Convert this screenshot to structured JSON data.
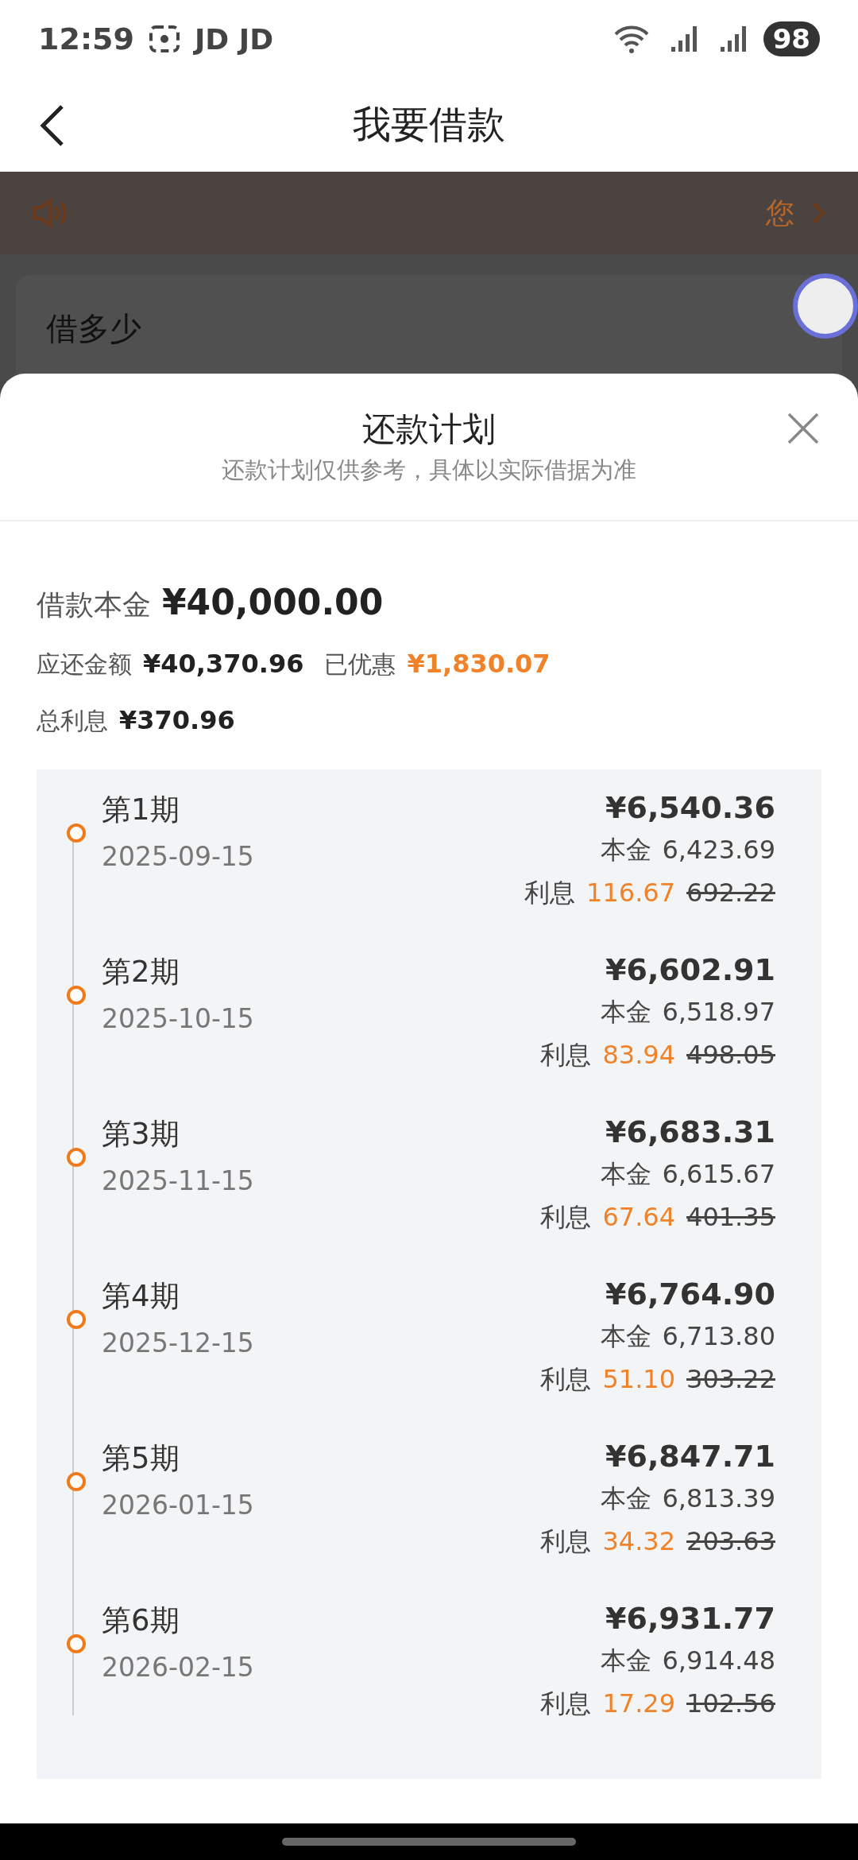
{
  "status_bar": {
    "time": "12:59",
    "carrier": "JD JD",
    "battery": "98"
  },
  "header": {
    "title": "我要借款"
  },
  "background": {
    "notice": "您",
    "card_label": "借多少"
  },
  "sheet": {
    "title": "还款计划",
    "subtitle": "还款计划仅供参考，具体以实际借据为准",
    "principal_label": "借款本金",
    "principal": "¥40,000.00",
    "due_label": "应还金额",
    "due": "¥40,370.96",
    "discount_label": "已优惠",
    "discount": "¥1,830.07",
    "interest_label": "总利息",
    "interest": "¥370.96",
    "periods": [
      {
        "period": "第1期",
        "date": "2025-09-15",
        "total": "¥6,540.36",
        "principal_label": "本金",
        "principal": "6,423.69",
        "interest_label": "利息",
        "interest": "116.67",
        "original_interest": "692.22"
      },
      {
        "period": "第2期",
        "date": "2025-10-15",
        "total": "¥6,602.91",
        "principal_label": "本金",
        "principal": "6,518.97",
        "interest_label": "利息",
        "interest": "83.94",
        "original_interest": "498.05"
      },
      {
        "period": "第3期",
        "date": "2025-11-15",
        "total": "¥6,683.31",
        "principal_label": "本金",
        "principal": "6,615.67",
        "interest_label": "利息",
        "interest": "67.64",
        "original_interest": "401.35"
      },
      {
        "period": "第4期",
        "date": "2025-12-15",
        "total": "¥6,764.90",
        "principal_label": "本金",
        "principal": "6,713.80",
        "interest_label": "利息",
        "interest": "51.10",
        "original_interest": "303.22"
      },
      {
        "period": "第5期",
        "date": "2026-01-15",
        "total": "¥6,847.71",
        "principal_label": "本金",
        "principal": "6,813.39",
        "interest_label": "利息",
        "interest": "34.32",
        "original_interest": "203.63"
      },
      {
        "period": "第6期",
        "date": "2026-02-15",
        "total": "¥6,931.77",
        "principal_label": "本金",
        "principal": "6,914.48",
        "interest_label": "利息",
        "interest": "17.29",
        "original_interest": "102.56"
      }
    ]
  }
}
